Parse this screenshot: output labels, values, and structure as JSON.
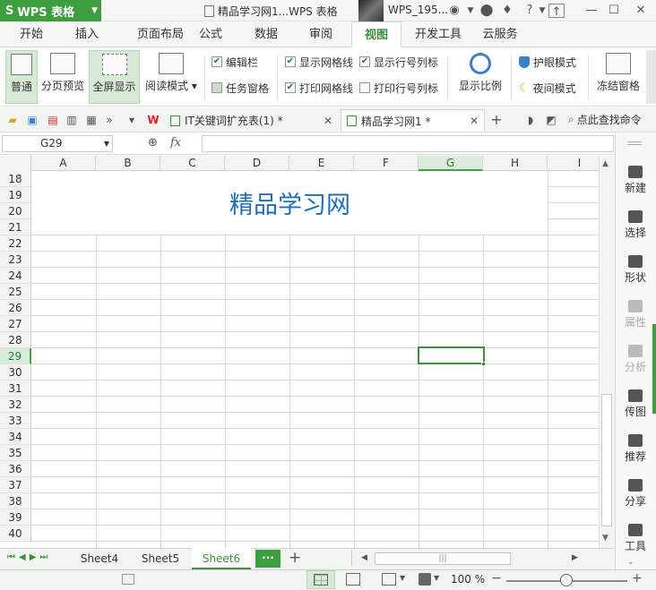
{
  "app": {
    "logo": "S",
    "name": "WPS 表格"
  },
  "window": {
    "doc_title": "精品学习网1...WPS 表格",
    "user": "WPS_195..."
  },
  "menu": {
    "tabs": [
      "开始",
      "插入",
      "页面布局",
      "公式",
      "数据",
      "审阅",
      "视图",
      "开发工具",
      "云服务"
    ],
    "active": "视图"
  },
  "ribbon": {
    "normal": "普通",
    "page_break_preview": "分页预览",
    "fullscreen": "全屏显示",
    "reading_mode": "阅读模式",
    "edit_bar": "编辑栏",
    "task_pane": "任务窗格",
    "show_gridlines": "显示网格线",
    "print_gridlines": "打印网格线",
    "show_headers": "显示行号列标",
    "print_headers": "打印行号列标",
    "zoom": "显示比例",
    "eye_mode": "护眼模式",
    "night_mode": "夜间模式",
    "freeze": "冻结窗格"
  },
  "checks": {
    "edit_bar": true,
    "task_pane": false,
    "show_gridlines": true,
    "print_gridlines": true,
    "show_headers": true,
    "print_headers": false
  },
  "doc_tabs": [
    {
      "label": "IT关键词扩充表(1) *",
      "active": false
    },
    {
      "label": "精品学习网1 *",
      "active": true
    }
  ],
  "find_command": "点此查找命令",
  "formula": {
    "cell_ref": "G29",
    "fx": "fx",
    "value": ""
  },
  "columns": [
    "A",
    "B",
    "C",
    "D",
    "E",
    "F",
    "G",
    "H",
    "I"
  ],
  "selected_col": "G",
  "rows": [
    "18",
    "19",
    "20",
    "21",
    "22",
    "23",
    "24",
    "25",
    "26",
    "27",
    "28",
    "29",
    "30",
    "31",
    "32",
    "33",
    "34",
    "35",
    "36",
    "37",
    "38",
    "39",
    "40"
  ],
  "selected_row": "29",
  "merged_title": "精品学习网",
  "right_panel": [
    {
      "label": "新建",
      "disabled": false
    },
    {
      "label": "选择",
      "disabled": false
    },
    {
      "label": "形状",
      "disabled": false
    },
    {
      "label": "属性",
      "disabled": true
    },
    {
      "label": "分析",
      "disabled": true
    },
    {
      "label": "传图",
      "disabled": false
    },
    {
      "label": "推荐",
      "disabled": false
    },
    {
      "label": "分享",
      "disabled": false
    },
    {
      "label": "工具",
      "disabled": false
    }
  ],
  "sheets": [
    "Sheet4",
    "Sheet5",
    "Sheet6"
  ],
  "active_sheet": "Sheet6",
  "more_sheets": "···",
  "add_sheet": "+",
  "status": {
    "zoom": "100 %",
    "zoom_level_percent": 100
  },
  "colors": {
    "accent": "#3e9d3e",
    "title_text": "#1f6fb6",
    "selection": "#3e8f3e"
  }
}
